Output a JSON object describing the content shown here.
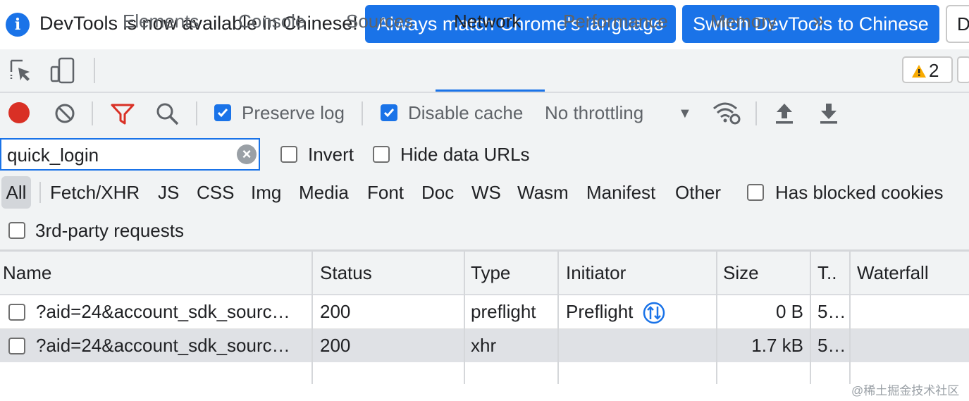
{
  "infobar": {
    "message": "DevTools is now available in Chinese!",
    "match_button": "Always match Chrome's language",
    "switch_button": "Switch DevTools to Chinese",
    "more_button": "Don't show again"
  },
  "tabs": [
    "Elements",
    "Console",
    "Sources",
    "Network",
    "Performance",
    "Memory"
  ],
  "active_tab": "Network",
  "more_tabs_icon": "»",
  "warnings_count": "2",
  "toolbar": {
    "preserve_log": "Preserve log",
    "preserve_log_checked": true,
    "disable_cache": "Disable cache",
    "disable_cache_checked": true,
    "throttling": "No throttling",
    "record_color": "#d93025",
    "filter_color": "#d93025"
  },
  "filter": {
    "value": "quick_login",
    "invert": "Invert",
    "hide_data_urls": "Hide data URLs",
    "types": [
      "All",
      "Fetch/XHR",
      "JS",
      "CSS",
      "Img",
      "Media",
      "Font",
      "Doc",
      "WS",
      "Wasm",
      "Manifest",
      "Other"
    ],
    "has_blocked_cookies": "Has blocked cookies",
    "third_party": "3rd-party requests"
  },
  "table": {
    "columns": [
      "Name",
      "Status",
      "Type",
      "Initiator",
      "Size",
      "T..",
      "Waterfall"
    ],
    "rows": [
      {
        "name": "?aid=24&account_sdk_sourc…",
        "status": "200",
        "type": "preflight",
        "initiator": "Preflight",
        "size": "0 B",
        "time": "5…"
      },
      {
        "name": "?aid=24&account_sdk_sourc…",
        "status": "200",
        "type": "xhr",
        "initiator": "",
        "size": "1.7 kB",
        "time": "5…"
      }
    ]
  },
  "watermark": "@稀土掘金技术社区"
}
